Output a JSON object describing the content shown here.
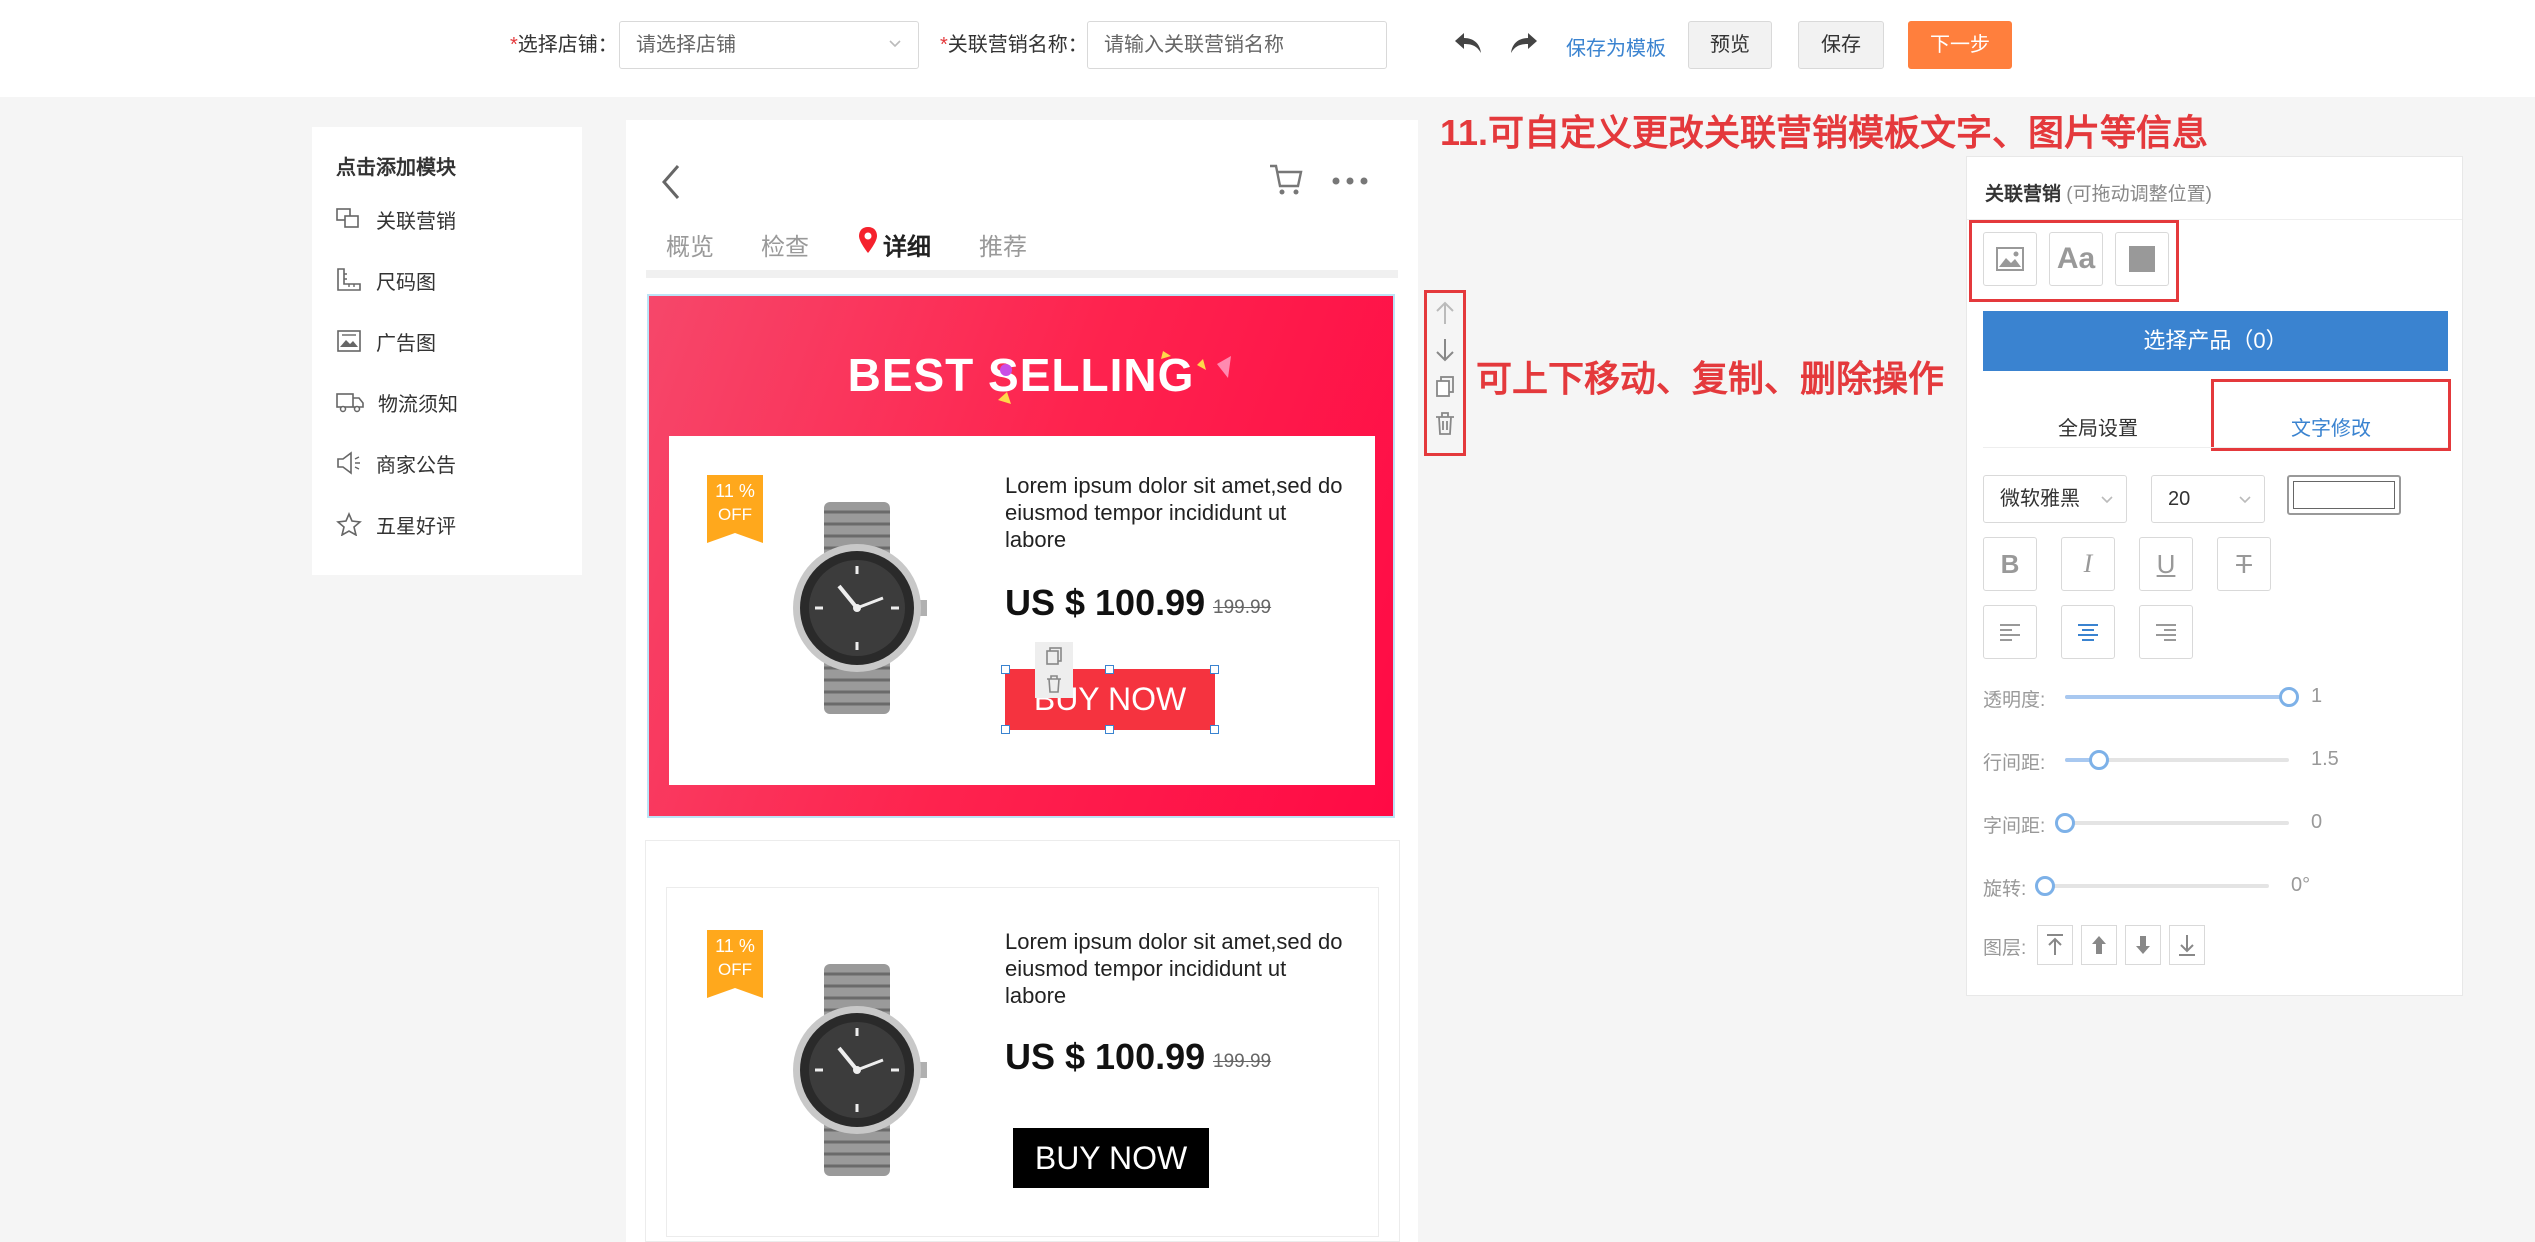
{
  "topbar": {
    "shop_label": "选择店铺",
    "shop_placeholder": "请选择店铺",
    "name_label": "关联营销名称",
    "name_placeholder": "请输入关联营销名称",
    "save_template": "保存为模板",
    "preview": "预览",
    "save": "保存",
    "next": "下一步",
    "required_mark": "*",
    "colon": "："
  },
  "left_panel": {
    "title": "点击添加模块",
    "items": [
      {
        "label": "关联营销",
        "icon": "related-marketing-icon"
      },
      {
        "label": "尺码图",
        "icon": "size-chart-icon"
      },
      {
        "label": "广告图",
        "icon": "ad-image-icon"
      },
      {
        "label": "物流须知",
        "icon": "truck-icon"
      },
      {
        "label": "商家公告",
        "icon": "announcement-icon"
      },
      {
        "label": "五星好评",
        "icon": "star-icon"
      }
    ]
  },
  "phone": {
    "tabs": [
      "概览",
      "检查",
      "详细",
      "推荐"
    ],
    "active_tab": 2
  },
  "banner": {
    "title": "BEST SELLING",
    "badge_line1": "11 %",
    "badge_line2": "OFF",
    "product_text": "Lorem ipsum dolor sit amet,sed do eiusmod tempor incididunt ut labore",
    "price": "US $ 100.99",
    "old_price": "199.99",
    "buy_now": "BUY NOW"
  },
  "card2": {
    "badge_line1": "11 %",
    "badge_line2": "OFF",
    "product_text": "Lorem ipsum dolor sit amet,sed do eiusmod tempor incididunt ut labore",
    "price": "US $ 100.99",
    "old_price": "199.99",
    "buy_now": "BUY NOW"
  },
  "hints": {
    "customize": "11.可自定义更改关联营销模板文字、图片等信息",
    "operations": "可上下移动、复制、删除操作"
  },
  "right_panel": {
    "title": "关联营销",
    "subtitle": "(可拖动调整位置)",
    "text_tool": "Aa",
    "select_products": "选择产品（0）",
    "tab_global": "全局设置",
    "tab_text": "文字修改",
    "font_family": "微软雅黑",
    "font_size": "20",
    "format_buttons": [
      "B",
      "I",
      "U",
      "T"
    ],
    "opacity_label": "透明度:",
    "opacity_value": "1",
    "opacity_level": 1.0,
    "line_height_label": "行间距:",
    "line_height_value": "1.5",
    "line_height_level": 0.15,
    "letter_spacing_label": "字间距:",
    "letter_spacing_value": "0",
    "letter_spacing_level": 0,
    "rotation_label": "旋转:",
    "rotation_value": "0°",
    "rotation_level": 0,
    "layer_label": "图层:"
  },
  "colors": {
    "accent_blue": "#3a83d0",
    "next_orange": "#ff7f3d",
    "hint_red": "#e4393c",
    "badge_orange": "#ffa81c",
    "banner_red": "#fe234e"
  }
}
